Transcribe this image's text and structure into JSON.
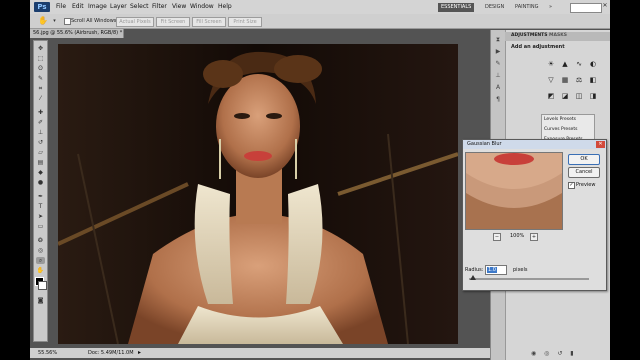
{
  "menubar": {
    "logo": "Ps",
    "items": [
      "File",
      "Edit",
      "Image",
      "Layer",
      "Select",
      "Filter",
      "View",
      "Window",
      "Help"
    ],
    "workspaces": [
      "ESSENTIALS",
      "DESIGN",
      "PAINTING"
    ],
    "workspace_more": "»"
  },
  "options": {
    "scroll_all_windows": "Scroll All Windows",
    "scroll_all_checked": false,
    "buttons": [
      "Actual Pixels",
      "Fit Screen",
      "Fill Screen",
      "Print Size"
    ]
  },
  "document": {
    "tab_title": "56.jpg @ 55.6% (Airbrush, RGB/8) *",
    "zoom": "55.56%",
    "doc_info": "Doc: 5.49M/11.0M"
  },
  "panel": {
    "tabs": [
      "ADJUSTMENTS",
      "MASKS"
    ],
    "title": "Add an adjustment",
    "presets": [
      "Levels Presets",
      "Curves Presets",
      "Exposure Presets"
    ]
  },
  "dialog": {
    "title": "Gaussian Blur",
    "ok_label": "OK",
    "cancel_label": "Cancel",
    "preview_label": "Preview",
    "preview_checked": true,
    "zoom_label": "100%",
    "zoom_out": "−",
    "zoom_in": "+",
    "radius_label": "Radius:",
    "radius_value": "1.0",
    "radius_unit": "pixels",
    "radius_slider_fraction": 0.03
  },
  "colors": {
    "accent": "#3d79c9",
    "chrome": "#d4d4d4",
    "workspace": "#535353"
  }
}
